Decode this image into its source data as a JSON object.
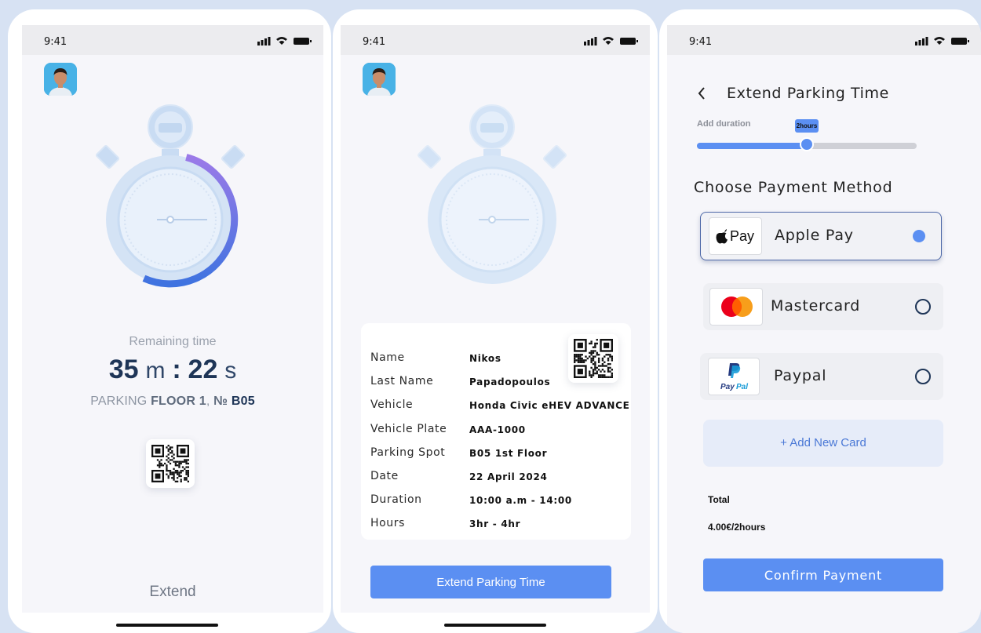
{
  "status_time": "9:41",
  "colors": {
    "accent": "#5b8ff2",
    "navy": "#1e3557",
    "background": "#d7e2f3"
  },
  "screen1": {
    "remaining_label": "Remaining time",
    "minutes": "35",
    "minutes_unit": "m",
    "separator": ":",
    "seconds": "22",
    "seconds_unit": "s",
    "parking_prefix": "PARKING",
    "floor_label": "FLOOR 1",
    "comma": ",",
    "spot_prefix": "№",
    "spot": "B05",
    "extend_label": "Extend",
    "progress_fraction": 0.4
  },
  "screen2": {
    "details": [
      {
        "label": "Name",
        "value": "Nikos"
      },
      {
        "label": "Last Name",
        "value": "Papadopoulos"
      },
      {
        "label": "Vehicle",
        "value": "Honda Civic eHEV ADVANCE"
      },
      {
        "label": "Vehicle Plate",
        "value": "AAA-1000"
      },
      {
        "label": "Parking Spot",
        "value": "B05 1st Floor"
      },
      {
        "label": "Date",
        "value": "22 April 2024"
      },
      {
        "label": "Duration",
        "value": "10:00 a.m - 14:00"
      },
      {
        "label": "Hours",
        "value": "3hr - 4hr"
      }
    ],
    "extend_button": "Extend Parking Time"
  },
  "screen3": {
    "title": "Extend Parking Time",
    "add_duration_label": "Add duration",
    "slider_value": "2hours",
    "slider_fraction": 0.5,
    "section_title": "Choose Payment Method",
    "methods": [
      {
        "name": "Apple Pay",
        "logo_text": "Pay",
        "selected": true
      },
      {
        "name": "Mastercard",
        "selected": false
      },
      {
        "name": "Paypal",
        "logo_text_1": "Pay",
        "logo_text_2": "Pal",
        "selected": false
      }
    ],
    "add_card": "+ Add New Card",
    "total_label": "Total",
    "total_value": "4.00€/2hours",
    "confirm_button": "Confirm Payment"
  }
}
